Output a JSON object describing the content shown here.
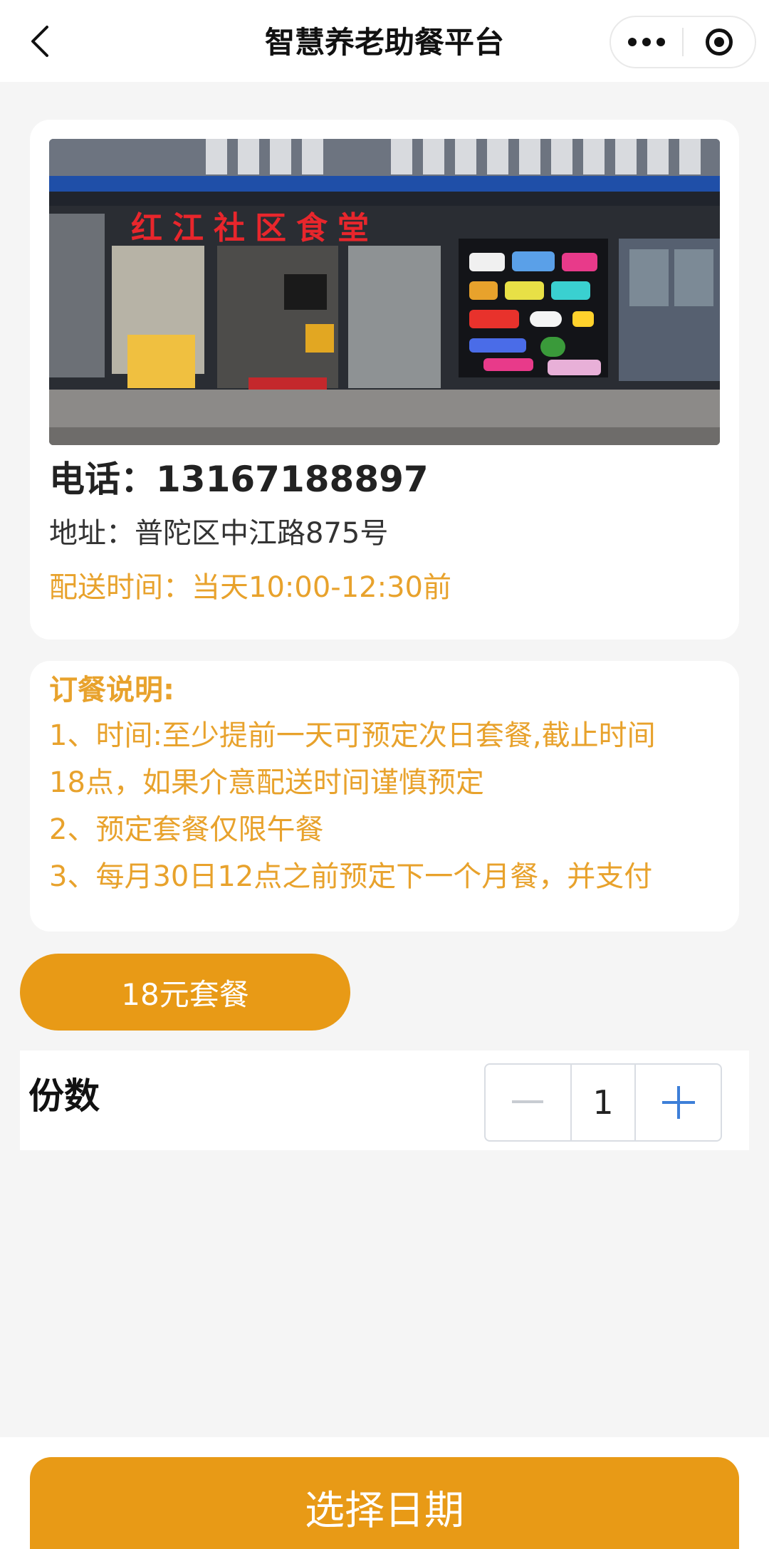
{
  "nav": {
    "title": "智慧养老助餐平台"
  },
  "store": {
    "photo_sign": "红江社区食堂",
    "phone_text": "电话：13167188897",
    "address_text": "地址：普陀区中江路875号",
    "delivery_text": "配送时间：当天10:00-12:30前"
  },
  "notice": {
    "title": "订餐说明:",
    "lines": [
      "1、时间:至少提前一天可预定次日套餐,截止时间",
      "18点，如果介意配送时间谨慎预定",
      "2、预定套餐仅限午餐",
      "3、每月30日12点之前预定下一个月餐，并支付"
    ]
  },
  "package": {
    "label": "18元套餐"
  },
  "quantity": {
    "label": "份数",
    "value": "1"
  },
  "bottom": {
    "button_label": "选择日期"
  },
  "colors": {
    "accent": "#e89a16",
    "notice_text": "#e8a22c"
  },
  "icons": {
    "back": "chevron-left-icon",
    "more": "more-dots-icon",
    "close": "target-icon",
    "minus": "minus-icon",
    "plus": "plus-icon"
  }
}
